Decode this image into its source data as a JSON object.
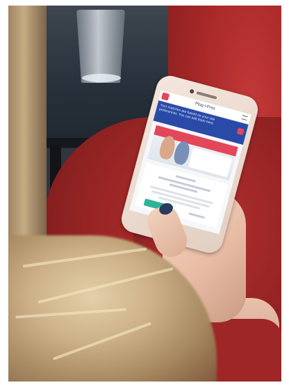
{
  "photo": {
    "subject": "",
    "elements": [
      "drinking-glass",
      "table",
      "red-sweater",
      "blonde-hair",
      "hand",
      "smartphone"
    ]
  },
  "phone_screen": {
    "header_title": "Plug-i-Pres",
    "banner_text": "Your matches are based on your site preferences. You can edit them here.",
    "accent_color": "#e4465a",
    "banner_color": "#2a4aa8",
    "button_color": "#2fb39a"
  }
}
